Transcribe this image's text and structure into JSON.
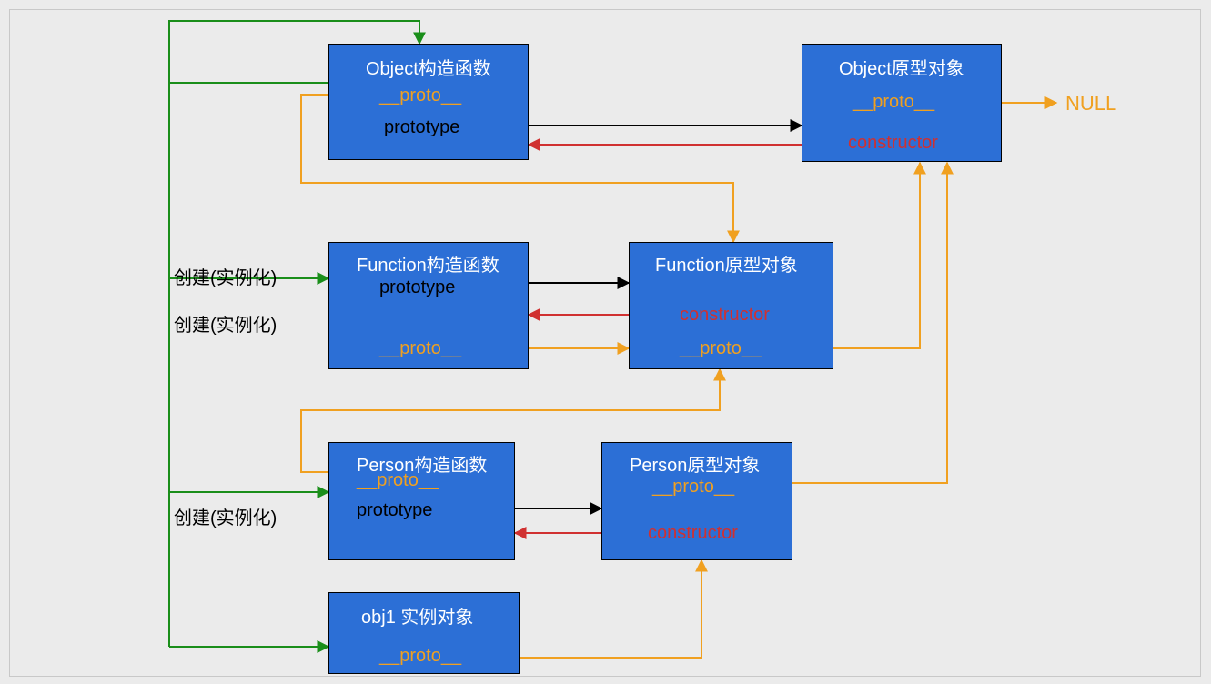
{
  "boxes": {
    "object_ctor": {
      "title": "Object构造函数",
      "proto": "__proto__",
      "prototype": "prototype"
    },
    "object_proto": {
      "title": "Object原型对象",
      "proto": "__proto__",
      "constructor": "constructor"
    },
    "function_ctor": {
      "title": "Function构造函数",
      "proto": "__proto__",
      "prototype": "prototype"
    },
    "function_proto": {
      "title": "Function原型对象",
      "proto": "__proto__",
      "constructor": "constructor"
    },
    "person_ctor": {
      "title": "Person构造函数",
      "proto": "__proto__",
      "prototype": "prototype"
    },
    "person_proto": {
      "title": "Person原型对象",
      "proto": "__proto__",
      "constructor": "constructor"
    },
    "obj1": {
      "title": "obj1 实例对象",
      "proto": "__proto__"
    }
  },
  "edges": {
    "create1": "创建(实例化)",
    "create2": "创建(实例化)",
    "create3": "创建(实例化)"
  },
  "null_label": "NULL",
  "colors": {
    "box_fill": "#2c6fd6",
    "orange": "#f0a020",
    "red": "#d03030",
    "green": "#1a8e1a",
    "black": "#000000"
  }
}
